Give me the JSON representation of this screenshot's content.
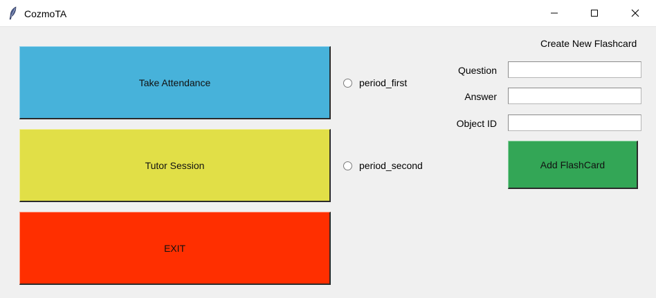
{
  "window": {
    "title": "CozmoTA",
    "icons": {
      "app": "feather-icon",
      "minimize": "minimize-icon",
      "maximize": "maximize-icon",
      "close": "close-icon"
    }
  },
  "actions": {
    "take_attendance": "Take Attendance",
    "tutor_session": "Tutor Session",
    "exit": "EXIT"
  },
  "periods": [
    {
      "label": "period_first",
      "selected": false
    },
    {
      "label": "period_second",
      "selected": false
    }
  ],
  "flashcard": {
    "heading": "Create New Flashcard",
    "question_label": "Question",
    "answer_label": "Answer",
    "object_id_label": "Object ID",
    "question_value": "",
    "answer_value": "",
    "object_id_value": "",
    "add_button": "Add FlashCard"
  },
  "colors": {
    "attendance_button": "#47b2da",
    "tutor_button": "#e1df47",
    "exit_button": "#ff2f00",
    "add_button": "#33a656",
    "background": "#f0f0f0"
  }
}
